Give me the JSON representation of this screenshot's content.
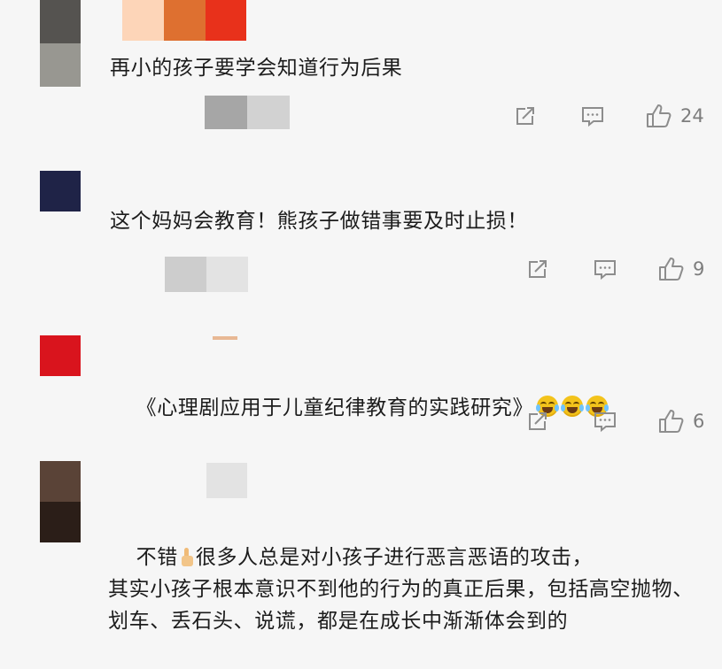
{
  "comments": [
    {
      "text": "再小的孩子要学会知道行为后果",
      "likes": "24"
    },
    {
      "text": "这个妈妈会教育！熊孩子做错事要及时止损！",
      "likes": "9"
    },
    {
      "text": "《心理剧应用于儿童纪律教育的实践研究》",
      "likes": "6",
      "emoji_icons": [
        "tears-of-joy-emoji",
        "tears-of-joy-emoji",
        "tears-of-joy-emoji"
      ]
    },
    {
      "text_before_icon": "不错",
      "text_after_icon": "很多人总是对小孩子进行恶言恶语的攻击，\n其实小孩子根本意识不到他的行为的真正后果，包括高空抛物、划车、丢石头、说谎，都是在成长中渐渐体会到的",
      "inline_icon": "thumbs-up-emoji"
    }
  ],
  "icons": {
    "repost": "repost-icon",
    "comment": "comment-icon",
    "like": "thumbs-up-icon"
  },
  "colors": {
    "background": "#f6f6f6",
    "text": "#1c1c1c",
    "action_gray": "#8d8d8d"
  }
}
